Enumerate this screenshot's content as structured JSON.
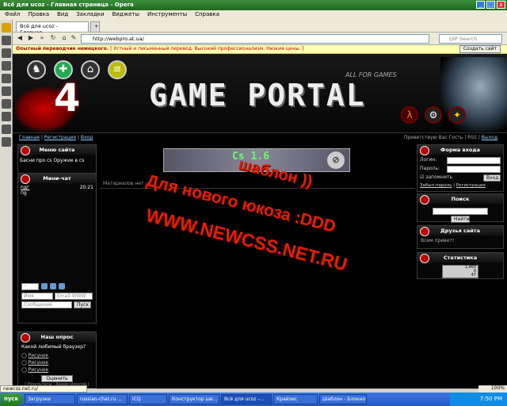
{
  "window": {
    "title": "Всё для ucoz - Главная страница - Opera"
  },
  "menu": [
    "Файл",
    "Правка",
    "Вид",
    "Закладки",
    "Виджеты",
    "Инструменты",
    "Справка"
  ],
  "tabs": [
    "Всё для ucoz - Главная..."
  ],
  "address": {
    "url": "http://webpro.at.ua/",
    "search_placeholder": "QIP Search"
  },
  "infobar": {
    "bold": "Опытный переводчик немецкого.",
    "text": "[ Устный и письменный перевод. Высокий профессионализм. Низкие цены. ]",
    "button": "Создать сайт"
  },
  "header": {
    "logo_num": "4",
    "title": "GAME PORTAL",
    "tagline": "ALL FOR GAMES"
  },
  "nav": {
    "links": [
      "Главная",
      "Регистрация",
      "Вход"
    ],
    "right": "Приветствую Вас Гость | RSS",
    "right_link": "Выход"
  },
  "left": {
    "site_menu_title": "Меню сайта",
    "site_menu_item": "Басни про cs Оружие в cs",
    "minichat_title": "Мини-чат",
    "chat": {
      "user": "пдг",
      "time": "20:21",
      "msg": "пg"
    },
    "chat_name_ph": "Имя",
    "chat_email_ph": "Email:WWW",
    "chat_msg_ph": "Сообщение",
    "chat_send": "Пуск",
    "poll_title": "Наш опрос",
    "poll_question": "Какой любимый браузер?",
    "poll_options": [
      "Рисунок",
      "Рисунок",
      "Рисунок"
    ],
    "poll_vote": "Оценить",
    "poll_results": "[ Результаты · Архив опросов ]"
  },
  "center": {
    "banner": "Cs 1.6",
    "materials": "Материалов нет"
  },
  "right": {
    "login_title": "Форма входа",
    "login_label": "Логин:",
    "pass_label": "Пароль:",
    "remember": "запомнить",
    "enter": "Вход",
    "forgot": "Забыл пароль",
    "register": "Регистрация",
    "search_title": "Поиск",
    "search_btn": "Найти",
    "friends_title": "Друзья сайта",
    "friends_text": "Всем привет!",
    "stats_title": "Статистика",
    "stats": [
      "1,469",
      "0",
      "47"
    ]
  },
  "overlay": {
    "l1": "шаблон ))",
    "l2": "Для нового юкоза :DDD",
    "l3": "WWW.NEWCSS.NET.RU"
  },
  "status": {
    "url": "newcss.net.ru/",
    "zoom": "100%"
  },
  "taskbar": {
    "start": "пуск",
    "tasks": [
      "Загрузки",
      "russian-chat.ru ...",
      "ICQ",
      "Конструктор ше...",
      "Всё для ucoz -...",
      "Крайзис",
      "Шаблон - Блокнот"
    ],
    "clock": "7:50 PM"
  }
}
